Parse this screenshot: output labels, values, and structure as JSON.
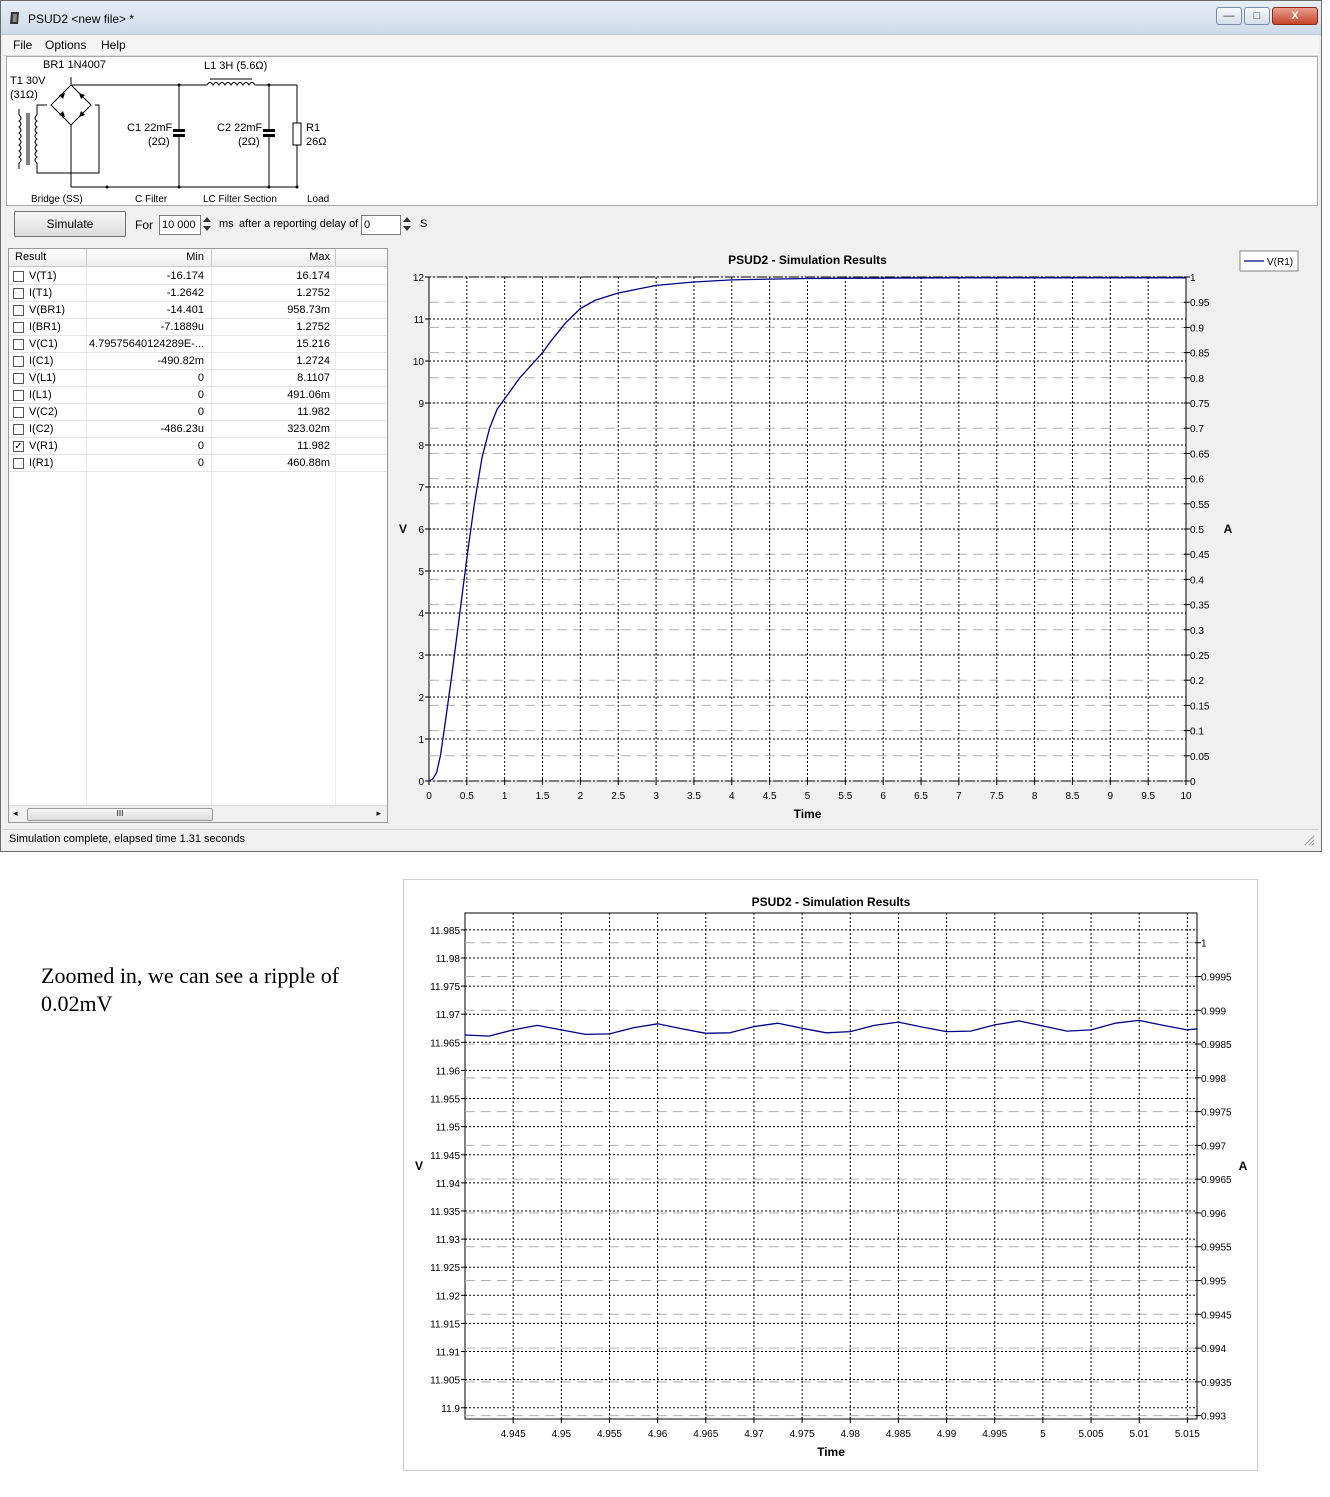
{
  "window": {
    "title": "PSUD2  <new file> *",
    "controls": {
      "minimize": "—",
      "maximize": "□",
      "close": "X"
    }
  },
  "menu": [
    "File",
    "Options",
    "Help"
  ],
  "schematic": {
    "labels": {
      "br1": "BR1 1N4007",
      "l1": "L1 3H (5.6Ω)",
      "t1a": "T1 30V",
      "t1b": "(31Ω)",
      "c1a": "C1 22mF",
      "c1b": "(2Ω)",
      "c2a": "C2 22mF",
      "c2b": "(2Ω)",
      "r1a": "R1",
      "r1b": "26Ω"
    },
    "sections": [
      "Bridge (SS)",
      "C Filter",
      "LC Filter Section",
      "Load"
    ]
  },
  "toolbar": {
    "simulate": "Simulate",
    "for_label": "For",
    "duration": "10 000",
    "ms_label": "ms",
    "after_label": "after a reporting delay of",
    "delay": "0",
    "s_label": "S"
  },
  "results": {
    "headers": [
      "Result",
      "Min",
      "Max"
    ],
    "rows": [
      {
        "name": "V(T1)",
        "min": "-16.174",
        "max": "16.174",
        "checked": false
      },
      {
        "name": "I(T1)",
        "min": "-1.2642",
        "max": "1.2752",
        "checked": false
      },
      {
        "name": "V(BR1)",
        "min": "-14.401",
        "max": "958.73m",
        "checked": false
      },
      {
        "name": "I(BR1)",
        "min": "-7.1889u",
        "max": "1.2752",
        "checked": false
      },
      {
        "name": "V(C1)",
        "min": "4.79575640124289E-...",
        "max": "15.216",
        "checked": false
      },
      {
        "name": "I(C1)",
        "min": "-490.82m",
        "max": "1.2724",
        "checked": false
      },
      {
        "name": "V(L1)",
        "min": "0",
        "max": "8.1107",
        "checked": false
      },
      {
        "name": "I(L1)",
        "min": "0",
        "max": "491.06m",
        "checked": false
      },
      {
        "name": "V(C2)",
        "min": "0",
        "max": "11.982",
        "checked": false
      },
      {
        "name": "I(C2)",
        "min": "-486.23u",
        "max": "323.02m",
        "checked": false
      },
      {
        "name": "V(R1)",
        "min": "0",
        "max": "11.982",
        "checked": true
      },
      {
        "name": "I(R1)",
        "min": "0",
        "max": "460.88m",
        "checked": false
      }
    ],
    "scroll_grip": "III"
  },
  "status": "Simulation complete, elapsed time 1.31 seconds",
  "chart_data": [
    {
      "type": "line",
      "title": "PSUD2 - Simulation Results",
      "xlabel": "Time",
      "ylabel": "V",
      "y2label": "A",
      "xlim": [
        0,
        10
      ],
      "ylim": [
        0,
        12
      ],
      "y2lim": [
        0,
        1
      ],
      "xticks": [
        "0",
        "0.5",
        "1",
        "1.5",
        "2",
        "2.5",
        "3",
        "3.5",
        "4",
        "4.5",
        "5",
        "5.5",
        "6",
        "6.5",
        "7",
        "7.5",
        "8",
        "8.5",
        "9",
        "9.5",
        "10"
      ],
      "yticks": [
        "0",
        "1",
        "2",
        "3",
        "4",
        "5",
        "6",
        "7",
        "8",
        "9",
        "10",
        "11",
        "12"
      ],
      "y2ticks": [
        "0",
        "0.05",
        "0.1",
        "0.15",
        "0.2",
        "0.25",
        "0.3",
        "0.35",
        "0.4",
        "0.45",
        "0.5",
        "0.55",
        "0.6",
        "0.65",
        "0.7",
        "0.75",
        "0.8",
        "0.85",
        "0.9",
        "0.95",
        "1"
      ],
      "legend": "top-right",
      "grid": true,
      "series": [
        {
          "name": "V(R1)",
          "color": "#00008b",
          "x": [
            0,
            0.05,
            0.1,
            0.15,
            0.2,
            0.3,
            0.4,
            0.5,
            0.6,
            0.7,
            0.8,
            0.9,
            1.0,
            1.2,
            1.4,
            1.5,
            1.6,
            1.8,
            2.0,
            2.2,
            2.5,
            3.0,
            3.5,
            4.0,
            4.5,
            5.0,
            6.0,
            7.0,
            8.0,
            9.0,
            10.0
          ],
          "y": [
            0,
            0.05,
            0.2,
            0.6,
            1.2,
            2.5,
            3.9,
            5.3,
            6.6,
            7.7,
            8.4,
            8.85,
            9.1,
            9.6,
            10.0,
            10.2,
            10.45,
            10.9,
            11.25,
            11.45,
            11.62,
            11.8,
            11.88,
            11.93,
            11.95,
            11.965,
            11.975,
            11.98,
            11.982,
            11.982,
            11.982
          ]
        }
      ]
    },
    {
      "type": "line",
      "title": "PSUD2 - Simulation Results",
      "xlabel": "Time",
      "ylabel": "V",
      "y2label": "A",
      "xlim": [
        4.94,
        5.016
      ],
      "ylim": [
        11.898,
        11.988
      ],
      "y2lim": [
        0.99295,
        1.00044
      ],
      "xticks": [
        "4.945",
        "4.95",
        "4.955",
        "4.96",
        "4.965",
        "4.97",
        "4.975",
        "4.98",
        "4.985",
        "4.99",
        "4.995",
        "5",
        "5.005",
        "5.01",
        "5.015"
      ],
      "yticks": [
        "11.9",
        "11.905",
        "11.91",
        "11.915",
        "11.92",
        "11.925",
        "11.93",
        "11.935",
        "11.94",
        "11.945",
        "11.95",
        "11.955",
        "11.96",
        "11.965",
        "11.97",
        "11.975",
        "11.98",
        "11.985"
      ],
      "y2ticks": [
        "0.993",
        "0.9935",
        "0.994",
        "0.9945",
        "0.995",
        "0.9955",
        "0.996",
        "0.9965",
        "0.997",
        "0.9975",
        "0.998",
        "0.9985",
        "0.999",
        "0.9995",
        "1"
      ],
      "grid": true,
      "series": [
        {
          "name": "V(R1)",
          "color": "#00008b",
          "ripple_period": 0.01,
          "x": [
            4.94,
            4.9425,
            4.945,
            4.9475,
            4.95,
            4.9525,
            4.955,
            4.9575,
            4.96,
            4.9625,
            4.965,
            4.9675,
            4.97,
            4.9725,
            4.975,
            4.9775,
            4.98,
            4.9825,
            4.985,
            4.9875,
            4.99,
            4.9925,
            4.995,
            4.9975,
            5.0,
            5.0025,
            5.005,
            5.0075,
            5.01,
            5.0125,
            5.015,
            5.016
          ],
          "y": [
            11.9663,
            11.9661,
            11.9672,
            11.968,
            11.9672,
            11.9664,
            11.9665,
            11.9676,
            11.9683,
            11.9674,
            11.9666,
            11.9667,
            11.9678,
            11.9684,
            11.9675,
            11.9667,
            11.9669,
            11.968,
            11.9686,
            11.9677,
            11.9669,
            11.967,
            11.9681,
            11.9688,
            11.9679,
            11.967,
            11.9672,
            11.9684,
            11.9689,
            11.968,
            11.9672,
            11.9674
          ]
        }
      ]
    }
  ],
  "caption": "Zoomed in, we can see a ripple of 0.02mV",
  "colors": {
    "trace": "#00008b",
    "grid": "#000000",
    "window_bg": "#f0f0f0"
  }
}
